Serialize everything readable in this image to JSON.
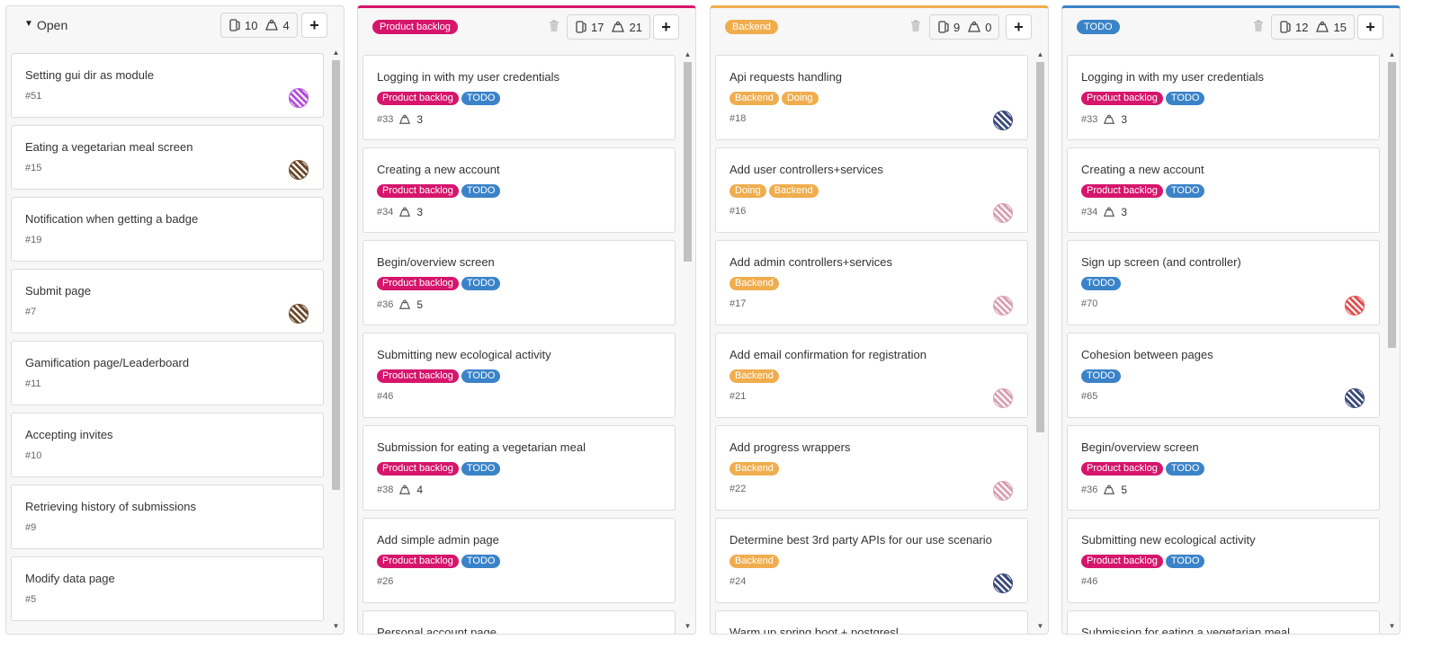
{
  "colors": {
    "product_backlog": "#d6156c",
    "todo": "#3b83c8",
    "backend": "#f0ad4e",
    "doing": "#f0ad4e"
  },
  "columns": [
    {
      "title": "Open",
      "icon": "chevron-down-icon",
      "issues": "10",
      "weight": "4",
      "add": "+",
      "cards": [
        {
          "title": "Setting gui dir as module",
          "number": "#51",
          "labels": [],
          "weight": null,
          "avatar": "purple"
        },
        {
          "title": "Eating a vegetarian meal screen",
          "number": "#15",
          "labels": [],
          "weight": null,
          "avatar": "brown"
        },
        {
          "title": "Notification when getting a badge",
          "number": "#19",
          "labels": [],
          "weight": null,
          "avatar": null
        },
        {
          "title": "Submit page",
          "number": "#7",
          "labels": [],
          "weight": null,
          "avatar": "brown"
        },
        {
          "title": "Gamification page/Leaderboard",
          "number": "#11",
          "labels": [],
          "weight": null,
          "avatar": null
        },
        {
          "title": "Accepting invites",
          "number": "#10",
          "labels": [],
          "weight": null,
          "avatar": null
        },
        {
          "title": "Retrieving history of submissions",
          "number": "#9",
          "labels": [],
          "weight": null,
          "avatar": null
        },
        {
          "title": "Modify data page",
          "number": "#5",
          "labels": [],
          "weight": null,
          "avatar": null
        }
      ]
    },
    {
      "title": "Product backlog",
      "issues": "17",
      "weight": "21",
      "add": "+",
      "cards": [
        {
          "title": "Logging in with my user credentials",
          "number": "#33",
          "labels": [
            "Product backlog",
            "TODO"
          ],
          "weight": "3",
          "avatar": null
        },
        {
          "title": "Creating a new account",
          "number": "#34",
          "labels": [
            "Product backlog",
            "TODO"
          ],
          "weight": "3",
          "avatar": null
        },
        {
          "title": "Begin/overview screen",
          "number": "#36",
          "labels": [
            "Product backlog",
            "TODO"
          ],
          "weight": "5",
          "avatar": null
        },
        {
          "title": "Submitting new ecological activity",
          "number": "#46",
          "labels": [
            "Product backlog",
            "TODO"
          ],
          "weight": null,
          "avatar": null
        },
        {
          "title": "Submission for eating a vegetarian meal",
          "number": "#38",
          "labels": [
            "Product backlog",
            "TODO"
          ],
          "weight": "4",
          "avatar": null
        },
        {
          "title": "Add simple admin page",
          "number": "#26",
          "labels": [
            "Product backlog",
            "TODO"
          ],
          "weight": null,
          "avatar": null
        },
        {
          "title": "Personal account page",
          "number": "",
          "labels": [],
          "weight": null,
          "avatar": null
        }
      ]
    },
    {
      "title": "Backend",
      "issues": "9",
      "weight": "0",
      "add": "+",
      "cards": [
        {
          "title": "Api requests handling",
          "number": "#18",
          "labels": [
            "Backend",
            "Doing"
          ],
          "weight": null,
          "avatar": "navy"
        },
        {
          "title": "Add user controllers+services",
          "number": "#16",
          "labels": [
            "Doing",
            "Backend"
          ],
          "weight": null,
          "avatar": "pink"
        },
        {
          "title": "Add admin controllers+services",
          "number": "#17",
          "labels": [
            "Backend"
          ],
          "weight": null,
          "avatar": "pink"
        },
        {
          "title": "Add email confirmation for registration",
          "number": "#21",
          "labels": [
            "Backend"
          ],
          "weight": null,
          "avatar": "pink"
        },
        {
          "title": "Add progress wrappers",
          "number": "#22",
          "labels": [
            "Backend"
          ],
          "weight": null,
          "avatar": "pink"
        },
        {
          "title": "Determine best 3rd party APIs for our use scenario",
          "number": "#24",
          "labels": [
            "Backend"
          ],
          "weight": null,
          "avatar": "navy"
        },
        {
          "title": "Warm up spring boot + postgresl",
          "number": "",
          "labels": [],
          "weight": null,
          "avatar": null
        }
      ]
    },
    {
      "title": "TODO",
      "issues": "12",
      "weight": "15",
      "add": "+",
      "cards": [
        {
          "title": "Logging in with my user credentials",
          "number": "#33",
          "labels": [
            "Product backlog",
            "TODO"
          ],
          "weight": "3",
          "avatar": null
        },
        {
          "title": "Creating a new account",
          "number": "#34",
          "labels": [
            "Product backlog",
            "TODO"
          ],
          "weight": "3",
          "avatar": null
        },
        {
          "title": "Sign up screen (and controller)",
          "number": "#70",
          "labels": [
            "TODO"
          ],
          "weight": null,
          "avatar": "red"
        },
        {
          "title": "Cohesion between pages",
          "number": "#65",
          "labels": [
            "TODO"
          ],
          "weight": null,
          "avatar": "navy"
        },
        {
          "title": "Begin/overview screen",
          "number": "#36",
          "labels": [
            "Product backlog",
            "TODO"
          ],
          "weight": "5",
          "avatar": null
        },
        {
          "title": "Submitting new ecological activity",
          "number": "#46",
          "labels": [
            "Product backlog",
            "TODO"
          ],
          "weight": null,
          "avatar": null
        },
        {
          "title": "Submission for eating a vegetarian meal",
          "number": "",
          "labels": [],
          "weight": null,
          "avatar": null
        }
      ]
    }
  ]
}
